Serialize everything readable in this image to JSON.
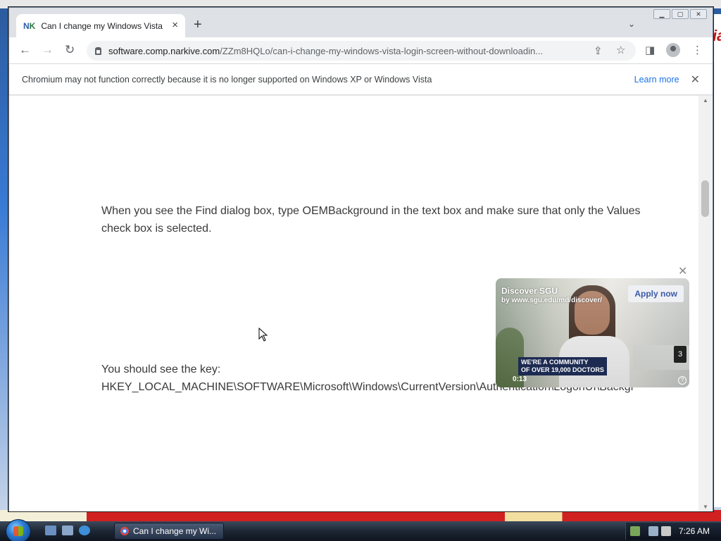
{
  "tab": {
    "favicon": "NK",
    "title": "Can I change my Windows Vista",
    "close_icon": "×",
    "new_tab_icon": "+"
  },
  "toolbar": {
    "url_host": "software.comp.narkive.com",
    "url_path": "/ZZm8HQLo/can-i-change-my-windows-vista-login-screen-without-downloadin..."
  },
  "infobar": {
    "message": "Chromium may not function correctly because it is no longer supported on Windows XP or Windows Vista",
    "learn_more": "Learn more",
    "close_icon": "✕"
  },
  "article": {
    "para1": "When you see the Find dialog box, type OEMBackground in the text box and make sure that only the Values check box is selected.",
    "para2_line1": "You should see the key:",
    "para2_line2": "HKEY_LOCAL_MACHINE\\SOFTWARE\\Microsoft\\Windows\\CurrentVersion\\Authentication\\LogonUI\\Backgr"
  },
  "ad": {
    "title": "Discover SGU",
    "subtitle": "by www.sgu.edu/md/discover/",
    "apply": "Apply now",
    "banner_line1": "WE'RE A COMMUNITY",
    "banner_line2": "OF OVER 19,000 DOCTORS",
    "time": "0:13",
    "count": "3",
    "help": "?",
    "close_icon": "✕"
  },
  "taskbar": {
    "task_label": "Can I change my Wi...",
    "clock": "7:26 AM"
  }
}
